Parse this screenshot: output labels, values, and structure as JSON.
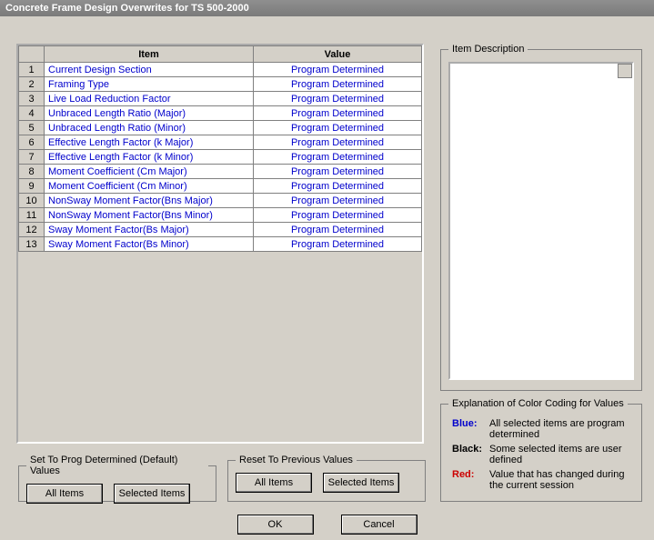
{
  "title": "Concrete Frame Design Overwrites for TS 500-2000",
  "table": {
    "col_item": "Item",
    "col_value": "Value",
    "rows": [
      {
        "n": "1",
        "item": "Current Design Section",
        "value": "Program Determined"
      },
      {
        "n": "2",
        "item": "Framing Type",
        "value": "Program Determined"
      },
      {
        "n": "3",
        "item": "Live Load Reduction Factor",
        "value": "Program Determined"
      },
      {
        "n": "4",
        "item": "Unbraced Length Ratio (Major)",
        "value": "Program Determined"
      },
      {
        "n": "5",
        "item": "Unbraced Length Ratio (Minor)",
        "value": "Program Determined"
      },
      {
        "n": "6",
        "item": "Effective Length Factor (k Major)",
        "value": "Program Determined"
      },
      {
        "n": "7",
        "item": "Effective Length Factor (k Minor)",
        "value": "Program Determined"
      },
      {
        "n": "8",
        "item": "Moment Coefficient (Cm Major)",
        "value": "Program Determined"
      },
      {
        "n": "9",
        "item": "Moment Coefficient (Cm Minor)",
        "value": "Program Determined"
      },
      {
        "n": "10",
        "item": "NonSway Moment Factor(Bns Major)",
        "value": "Program Determined"
      },
      {
        "n": "11",
        "item": "NonSway Moment Factor(Bns Minor)",
        "value": "Program Determined"
      },
      {
        "n": "12",
        "item": "Sway Moment Factor(Bs Major)",
        "value": "Program Determined"
      },
      {
        "n": "13",
        "item": "Sway Moment Factor(Bs Minor)",
        "value": "Program Determined"
      }
    ]
  },
  "groups": {
    "setprog_legend": "Set To Prog Determined (Default) Values",
    "reset_legend": "Reset To Previous Values",
    "desc_legend": "Item Description",
    "color_legend": "Explanation of Color Coding for Values"
  },
  "buttons": {
    "all_items": "All Items",
    "selected_items": "Selected Items",
    "ok": "OK",
    "cancel": "Cancel"
  },
  "color_coding": {
    "blue_label": "Blue:",
    "blue_text": "All selected items are program determined",
    "black_label": "Black:",
    "black_text": "Some selected items are user defined",
    "red_label": "Red:",
    "red_text": "Value that has changed during the current session"
  }
}
